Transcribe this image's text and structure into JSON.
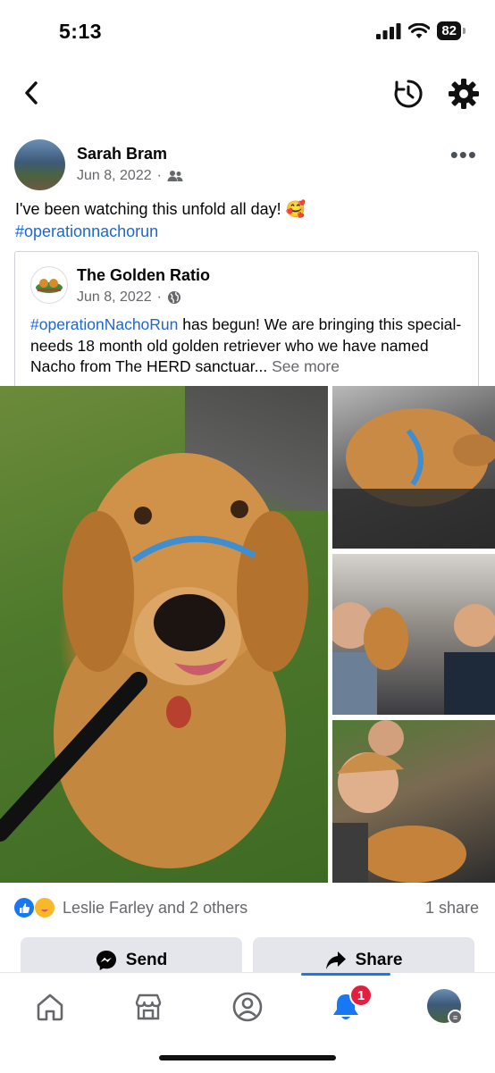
{
  "status_bar": {
    "time": "5:13",
    "battery": "82"
  },
  "header": {
    "back_icon": "chevron-left-icon",
    "history_icon": "activity-history-icon",
    "settings_icon": "gear-icon"
  },
  "post": {
    "author": "Sarah Bram",
    "date": "Jun 8, 2022",
    "separator": "·",
    "audience_icon": "friends-icon",
    "more_label": "•••",
    "text": "I've been watching this unfold all day! 🥰",
    "hashtag": "#operationnachorun",
    "shared": {
      "page_name": "The Golden Ratio",
      "date": "Jun 8, 2022",
      "separator": "·",
      "audience_icon": "globe-icon",
      "hashtag": "#operationNachoRun",
      "text": " has begun! We are bringing this special-needs 18 month old golden retriever who we have named Nacho from The HERD sanctuar...",
      "see_more": " See more"
    },
    "reactions": {
      "icons": [
        "like-icon",
        "care-icon"
      ],
      "summary": "Leslie Farley and 2 others",
      "shares": "1 share"
    },
    "actions": {
      "send_label": "Send",
      "share_label": "Share"
    }
  },
  "tabbar": {
    "items": [
      "home-icon",
      "marketplace-icon",
      "profile-icon",
      "notifications-icon",
      "menu-icon"
    ],
    "notification_count": "1",
    "active": "notifications"
  },
  "colors": {
    "accent": "#1877f2",
    "hashtag": "#1b67d4",
    "badge": "#e41e3f",
    "button_bg": "#e4e6eb",
    "secondary_text": "#65676b"
  }
}
